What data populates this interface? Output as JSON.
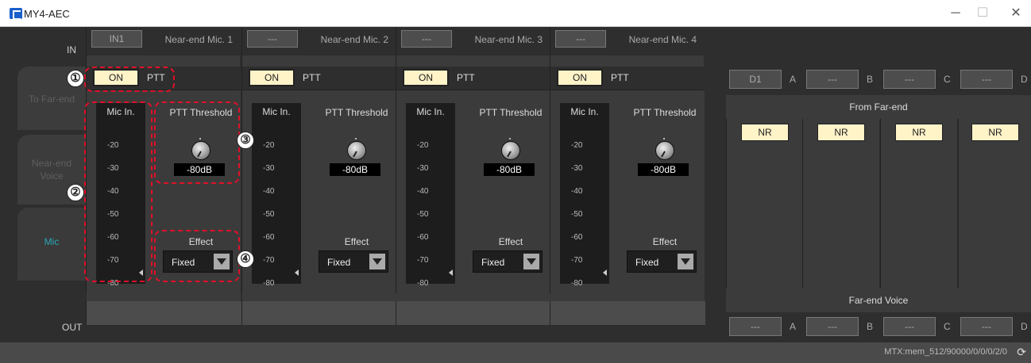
{
  "window": {
    "title": "MY4-AEC",
    "min": "─",
    "max": "☐",
    "close": "✕"
  },
  "labels": {
    "in": "IN",
    "out": "OUT"
  },
  "side_tabs": [
    {
      "label": "To Far-end"
    },
    {
      "label": "Near-end Voice"
    },
    {
      "label": "Mic"
    }
  ],
  "channels": [
    {
      "input": "IN1",
      "name": "Near-end Mic. 1",
      "on": "ON",
      "ptt": "PTT",
      "meter_title": "Mic In.",
      "ptt_title": "PTT Threshold",
      "threshold": "-80dB",
      "effect_title": "Effect",
      "effect": "Fixed"
    },
    {
      "input": "---",
      "name": "Near-end Mic. 2",
      "on": "ON",
      "ptt": "PTT",
      "meter_title": "Mic In.",
      "ptt_title": "PTT Threshold",
      "threshold": "-80dB",
      "effect_title": "Effect",
      "effect": "Fixed"
    },
    {
      "input": "---",
      "name": "Near-end Mic. 3",
      "on": "ON",
      "ptt": "PTT",
      "meter_title": "Mic In.",
      "ptt_title": "PTT Threshold",
      "threshold": "-80dB",
      "effect_title": "Effect",
      "effect": "Fixed"
    },
    {
      "input": "---",
      "name": "Near-end Mic. 4",
      "on": "ON",
      "ptt": "PTT",
      "meter_title": "Mic In.",
      "ptt_title": "PTT Threshold",
      "threshold": "-80dB",
      "effect_title": "Effect",
      "effect": "Fixed"
    }
  ],
  "meter_ticks": [
    "-20",
    "-30",
    "-40",
    "-50",
    "-60",
    "-70",
    "-80"
  ],
  "far_inputs": [
    {
      "input": "D1",
      "letter": "A"
    },
    {
      "input": "---",
      "letter": "B"
    },
    {
      "input": "---",
      "letter": "C"
    },
    {
      "input": "---",
      "letter": "D"
    }
  ],
  "far_outputs": [
    {
      "input": "---",
      "letter": "A"
    },
    {
      "input": "---",
      "letter": "B"
    },
    {
      "input": "---",
      "letter": "C"
    },
    {
      "input": "---",
      "letter": "D"
    }
  ],
  "from_far_end": "From Far-end",
  "far_end_voice": "Far-end Voice",
  "nr_label": "NR",
  "callouts": [
    "①",
    "②",
    "③",
    "④"
  ],
  "status": "MTX:mem_512/90000/0/0/0/2/0",
  "refresh_icon": "⟳"
}
